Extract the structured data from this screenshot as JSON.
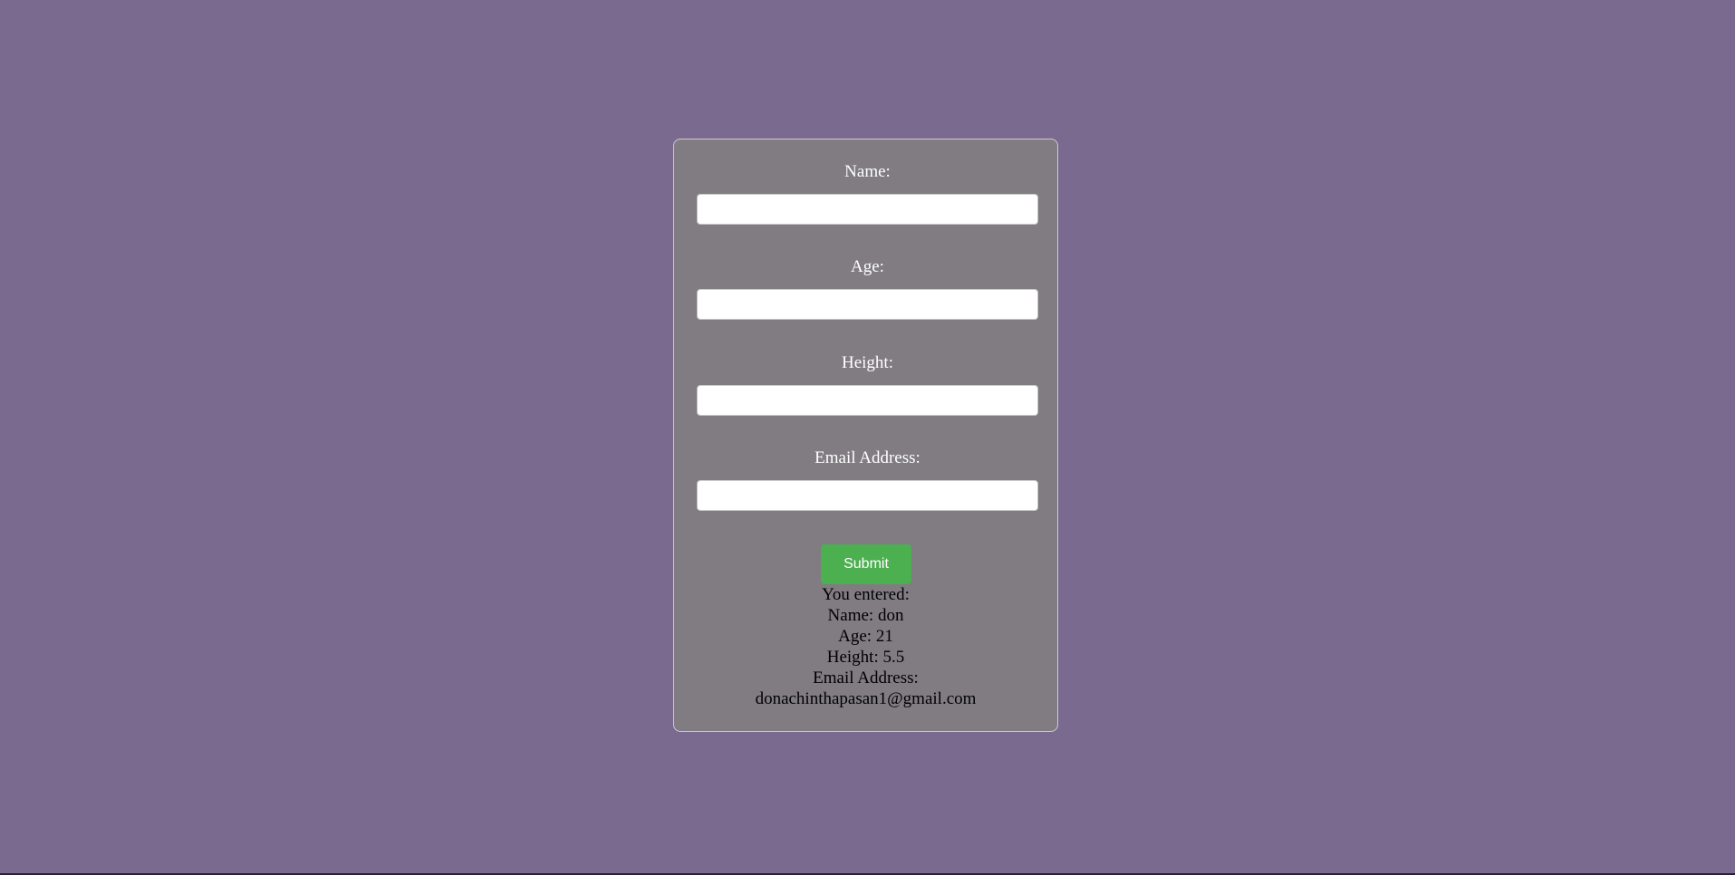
{
  "colors": {
    "page_background": "#7b6a8f",
    "card_background": "#807c82",
    "submit_background": "#4caf50"
  },
  "form": {
    "name_label": "Name:",
    "name_value": "",
    "age_label": "Age:",
    "age_value": "",
    "height_label": "Height:",
    "height_value": "",
    "email_label": "Email Address:",
    "email_value": "",
    "submit_label": "Submit"
  },
  "result": {
    "heading": "You entered:",
    "name_line": "Name: don",
    "age_line": "Age: 21",
    "height_line": "Height: 5.5",
    "email_line": "Email Address:",
    "email_value": "donachinthapasan1@gmail.com"
  }
}
